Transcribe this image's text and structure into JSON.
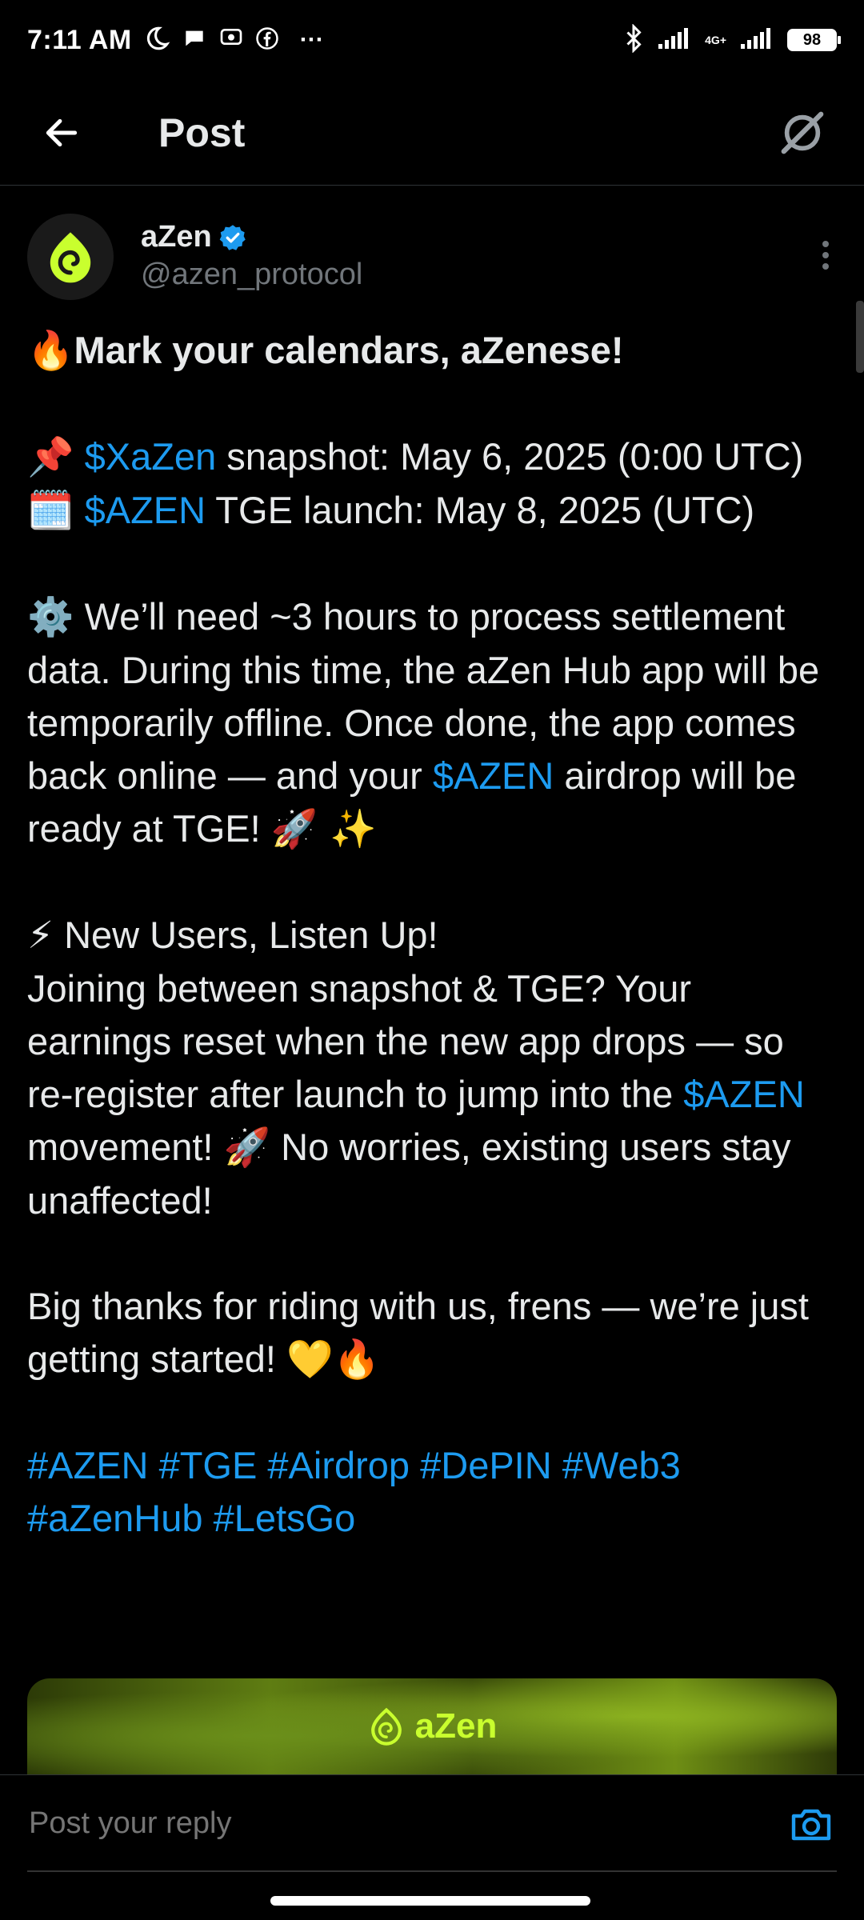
{
  "status_bar": {
    "time": "7:11 AM",
    "network": "4G+",
    "battery": "98",
    "overflow": "···"
  },
  "header": {
    "title": "Post"
  },
  "post": {
    "author": {
      "name": "aZen",
      "handle": "@azen_protocol",
      "verified": true
    },
    "body": {
      "p1": {
        "emoji": "🔥",
        "text": "Mark your calendars, aZenese!"
      },
      "p2": {
        "line1_emoji": "📌",
        "line1_link": "$XaZen",
        "line1_text": " snapshot: May 6, 2025 (0:00 UTC)",
        "line2_emoji": "🗓️",
        "line2_link": "$AZEN",
        "line2_text": " TGE launch: May 8, 2025 (UTC)"
      },
      "p3": {
        "emoji": "⚙️",
        "text_a": " We’ll need ~3 hours to process settlement data. During this time, the aZen Hub app will be temporarily offline. Once done, the app comes back online — and your ",
        "link": "$AZEN",
        "text_b": " airdrop will be ready at TGE! ",
        "emoji_end": "🚀 ✨"
      },
      "p4": {
        "emoji": "⚡",
        "heading": " New Users, Listen Up!",
        "text_a": "Joining between snapshot & TGE? Your earnings reset when the new app drops — so re-register after launch to jump into the ",
        "link": "$AZEN",
        "text_b": " movement! ",
        "emoji_mid": "🚀",
        "text_c": " No worries, existing users stay unaffected!"
      },
      "p5": {
        "text": "Big thanks for riding with us, frens — we’re just getting started! ",
        "emoji_end": "💛🔥"
      },
      "hashtags": [
        "#AZEN",
        "#TGE",
        "#Airdrop",
        "#DePIN",
        "#Web3",
        "#aZenHub",
        "#LetsGo"
      ]
    },
    "media": {
      "logo_text": "aZen"
    }
  },
  "reply": {
    "placeholder": "Post your reply"
  },
  "colors": {
    "background": "#000000",
    "text": "#e7e9ea",
    "muted": "#71767b",
    "link": "#1d9bf0",
    "verified": "#1d9bf0",
    "brand": "#c9ff2e"
  },
  "icons": [
    "back-arrow-icon",
    "grok-icon",
    "verified-badge-icon",
    "more-vertical-icon",
    "camera-icon",
    "moon-icon",
    "chat-bubble-icon",
    "facebook-icon",
    "bluetooth-icon",
    "signal-icon",
    "battery-icon"
  ]
}
